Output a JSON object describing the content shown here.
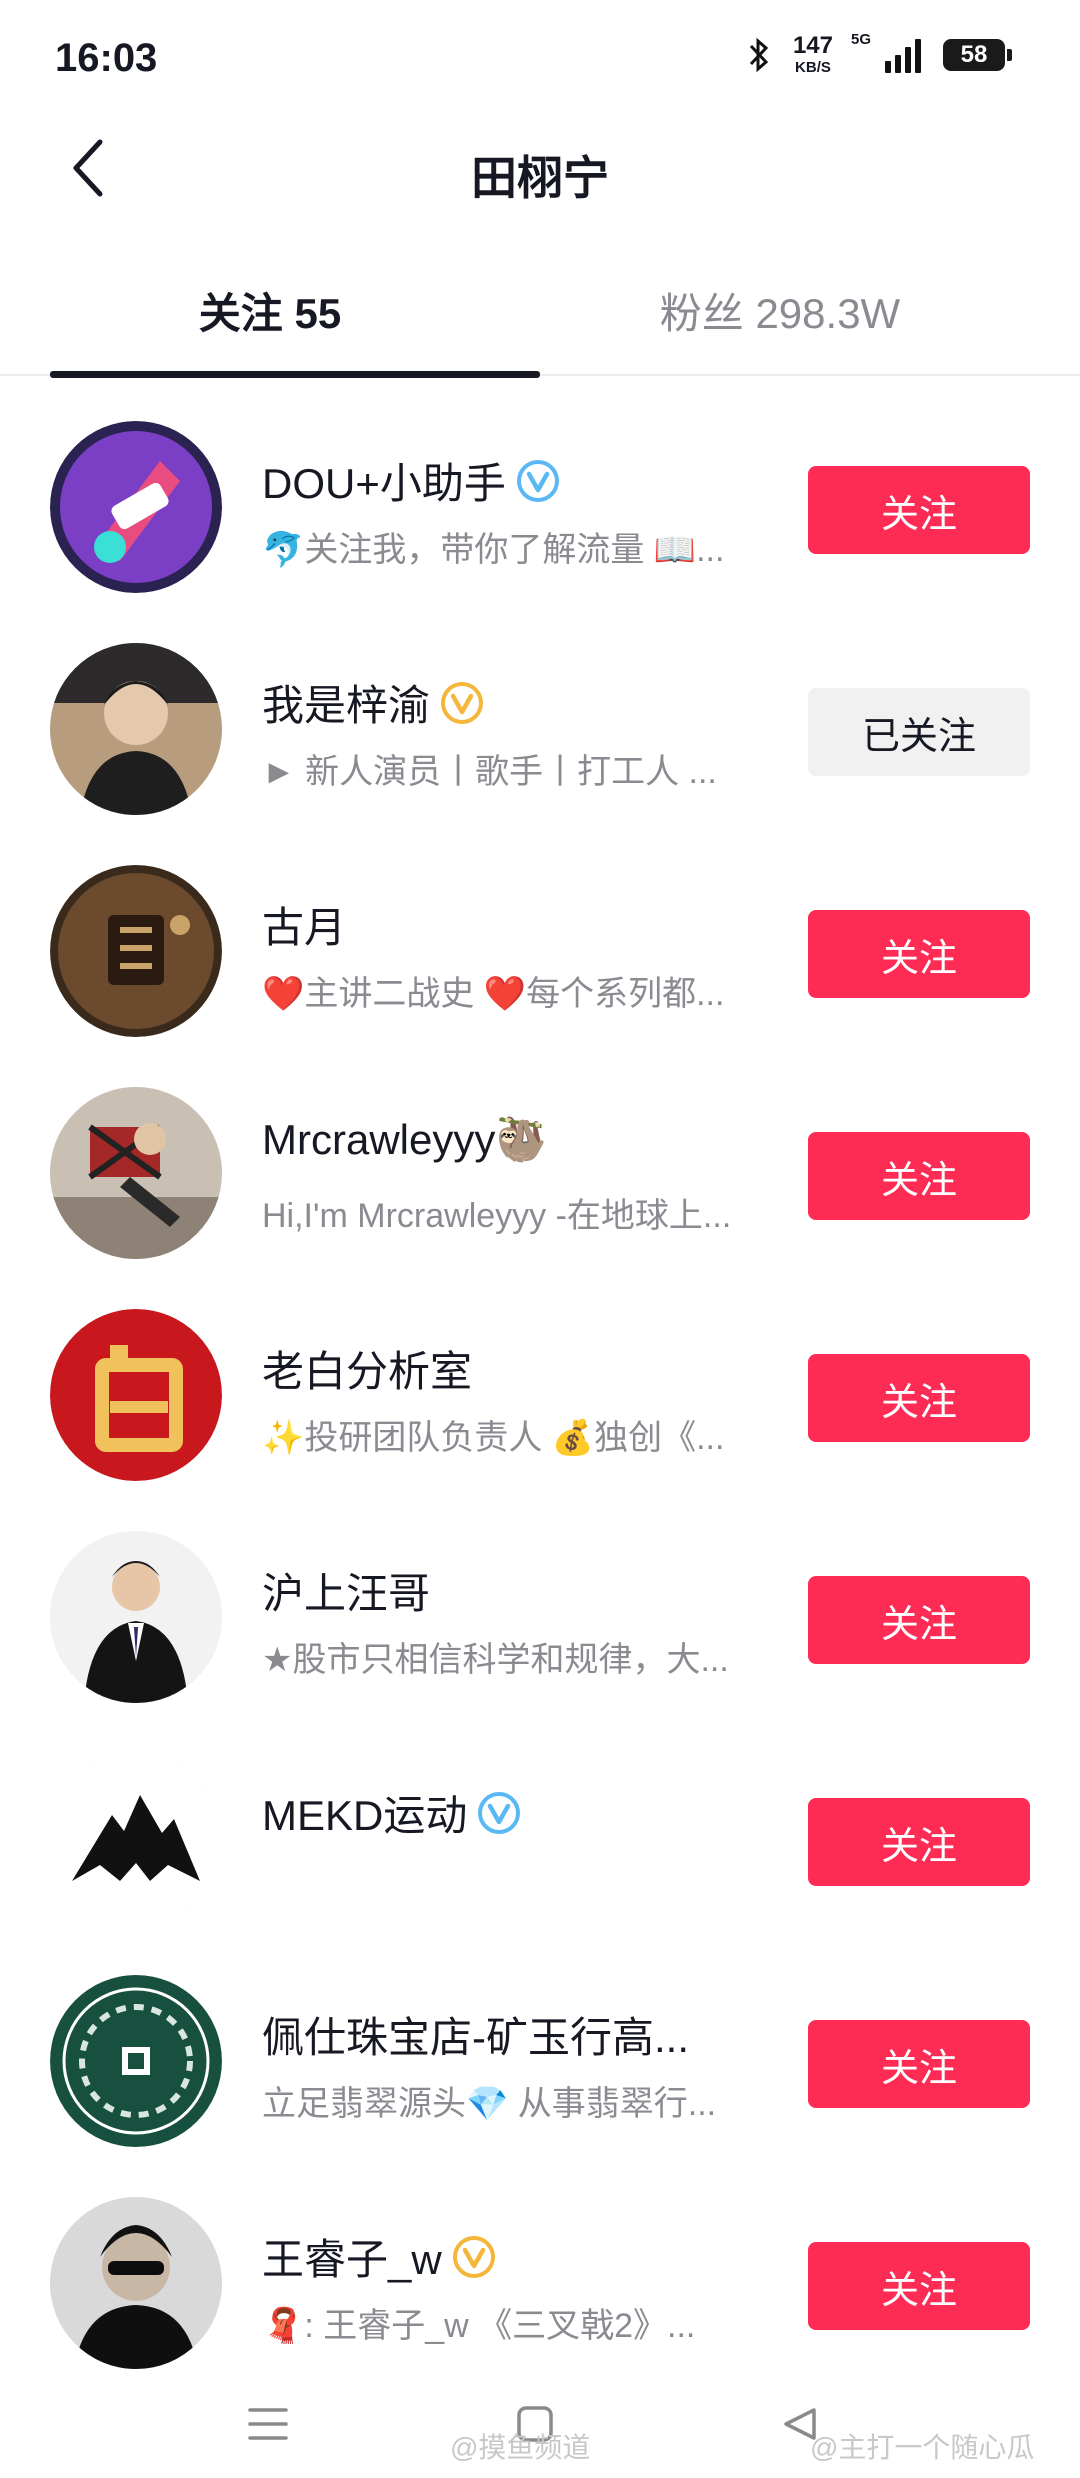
{
  "status": {
    "time": "16:03",
    "net_speed": "147",
    "net_unit": "KB/S",
    "network": "5G",
    "battery": "58"
  },
  "header": {
    "title": "田栩宁",
    "back_icon": "chevron-left-icon"
  },
  "tabs": [
    {
      "label": "关注 55",
      "active": true
    },
    {
      "label": "粉丝 298.3W",
      "active": false
    }
  ],
  "follow_list": [
    {
      "name": "DOU+小助手",
      "verified": "blue",
      "bio": "🐬关注我，带你了解流量 📖...",
      "button": "关注",
      "followed": false
    },
    {
      "name": "我是梓渝",
      "verified": "gold",
      "bio": "► 新人演员丨歌手丨打工人 ...",
      "button": "已关注",
      "followed": true
    },
    {
      "name": "古月",
      "verified": "",
      "bio": "❤️主讲二战史 ❤️每个系列都...",
      "button": "关注",
      "followed": false
    },
    {
      "name": "Mrcrawleyyy🦥",
      "verified": "",
      "bio": "Hi,I'm Mrcrawleyyy -在地球上...",
      "button": "关注",
      "followed": false
    },
    {
      "name": "老白分析室",
      "verified": "",
      "bio": "✨投研团队负责人 💰独创《...",
      "button": "关注",
      "followed": false
    },
    {
      "name": "沪上汪哥",
      "verified": "",
      "bio": "★股市只相信科学和规律，大...",
      "button": "关注",
      "followed": false
    },
    {
      "name": "MEKD运动",
      "verified": "blue",
      "bio": "",
      "button": "关注",
      "followed": false
    },
    {
      "name": "佩仕珠宝店-矿玉行高...",
      "verified": "",
      "bio": "立足翡翠源头💎 从事翡翠行...",
      "button": "关注",
      "followed": false
    },
    {
      "name": "王睿子_w",
      "verified": "gold",
      "bio": "🧣: 王睿子_w 《三叉戟2》...",
      "button": "关注",
      "followed": false
    }
  ],
  "colors": {
    "accent": "#fe2c55",
    "text_primary": "#161823",
    "text_secondary": "#8a8b91",
    "verified_blue": "#5ab8f5",
    "verified_gold": "#f4b63b"
  },
  "nav": {
    "menu_icon": "menu-icon",
    "home_icon": "home-square-icon",
    "back_icon": "back-triangle-icon"
  },
  "watermarks": [
    "@摸鱼频道",
    "@主打一个随心瓜"
  ]
}
